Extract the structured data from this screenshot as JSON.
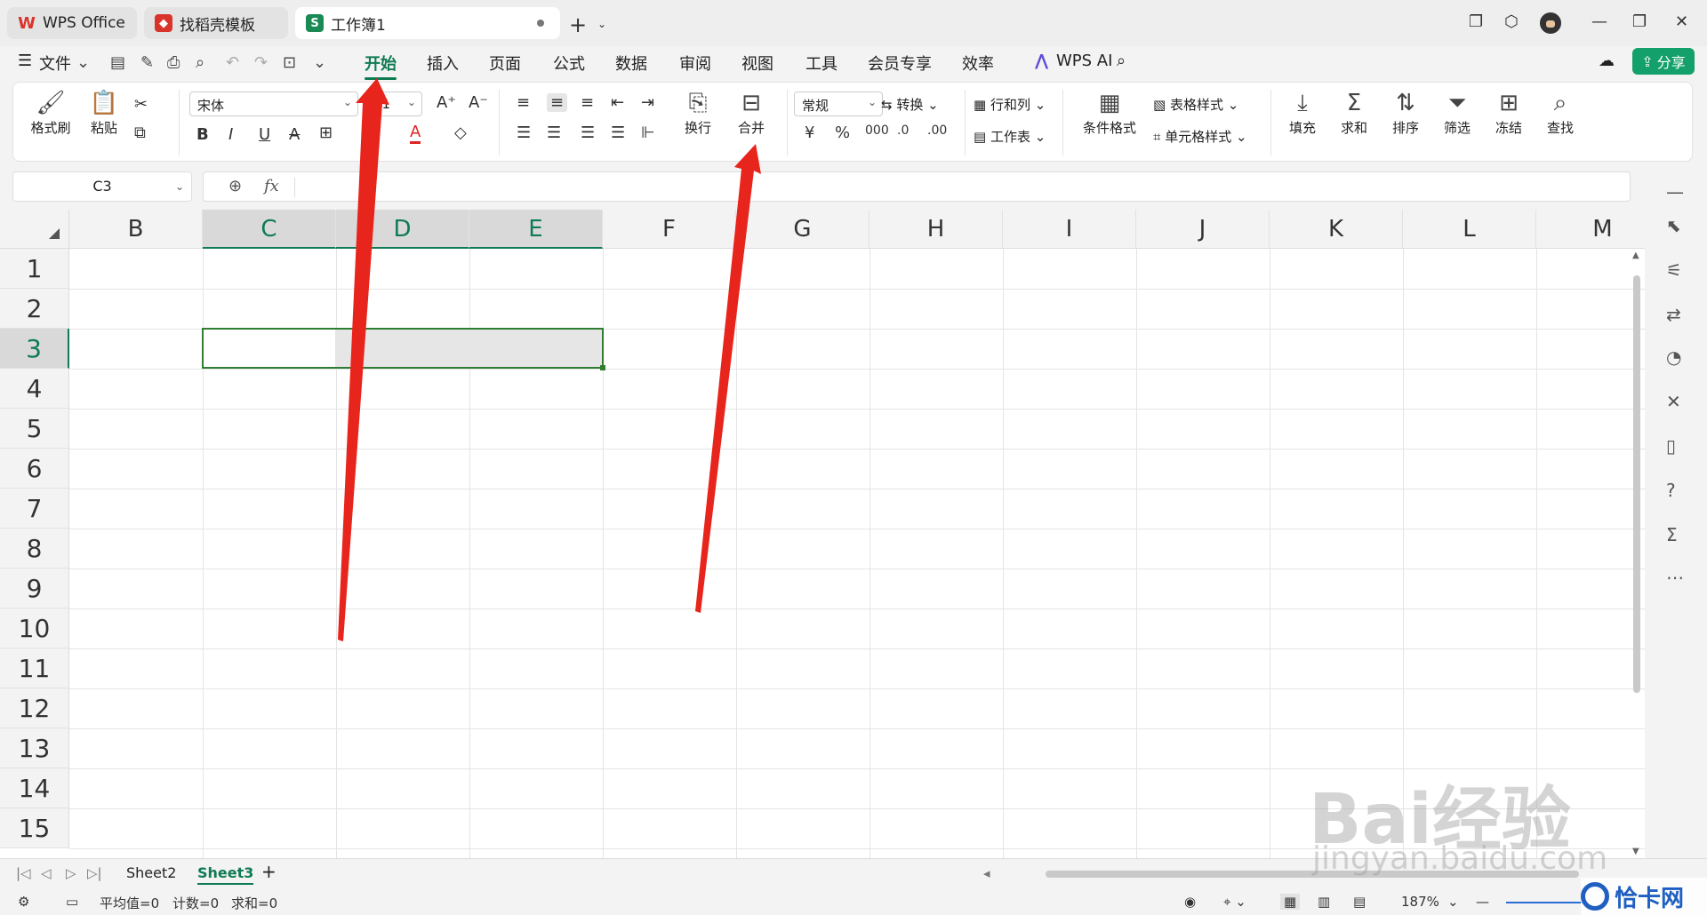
{
  "tabs": [
    {
      "label": "WPS Office",
      "icon": "wps-logo-icon",
      "color": "#d9342b"
    },
    {
      "label": "找稻壳模板",
      "icon": "docer-logo-icon",
      "color": "#d9342b"
    },
    {
      "label": "工作簿1",
      "icon": "sheet-logo-icon",
      "color": "#1a8a55",
      "icon_text": "S"
    }
  ],
  "menus": {
    "file": "文件",
    "items": [
      "开始",
      "插入",
      "页面",
      "公式",
      "数据",
      "审阅",
      "视图",
      "工具",
      "会员专享",
      "效率"
    ],
    "active": "开始",
    "wps_ai": "WPS AI",
    "share": "分享"
  },
  "ribbon": {
    "format_painter": "格式刷",
    "paste": "粘贴",
    "font_name": "宋体",
    "font_size": "11",
    "wrap": "换行",
    "merge": "合并",
    "number_format": "常规",
    "convert": "转换",
    "row_col": "行和列",
    "worksheet": "工作表",
    "cond_format": "条件格式",
    "table_style": "表格样式",
    "cell_style": "单元格样式",
    "fill": "填充",
    "sum": "求和",
    "sort": "排序",
    "filter": "筛选",
    "freeze": "冻结",
    "find": "查找"
  },
  "formula": {
    "name_box": "C3",
    "fx": "fx",
    "value": ""
  },
  "grid": {
    "columns": [
      "B",
      "C",
      "D",
      "E",
      "F",
      "G",
      "H",
      "I",
      "J",
      "K",
      "L",
      "M"
    ],
    "rows": [
      "1",
      "2",
      "3",
      "4",
      "5",
      "6",
      "7",
      "8",
      "9",
      "10",
      "11",
      "12",
      "13",
      "14",
      "15"
    ],
    "selected_columns": [
      "C",
      "D",
      "E"
    ],
    "selected_row": "3",
    "accent": "#0f7b53"
  },
  "sheets": {
    "tabs": [
      "Sheet2",
      "Sheet3"
    ],
    "active": "Sheet3"
  },
  "status": {
    "avg": "平均值=0",
    "count": "计数=0",
    "sum": "求和=0",
    "zoom": "187%"
  },
  "watermark": {
    "brand": "Bai经验",
    "url": "jingyan.baidu.com",
    "site": "恰卡网"
  },
  "annotation_color": "#e8251c"
}
